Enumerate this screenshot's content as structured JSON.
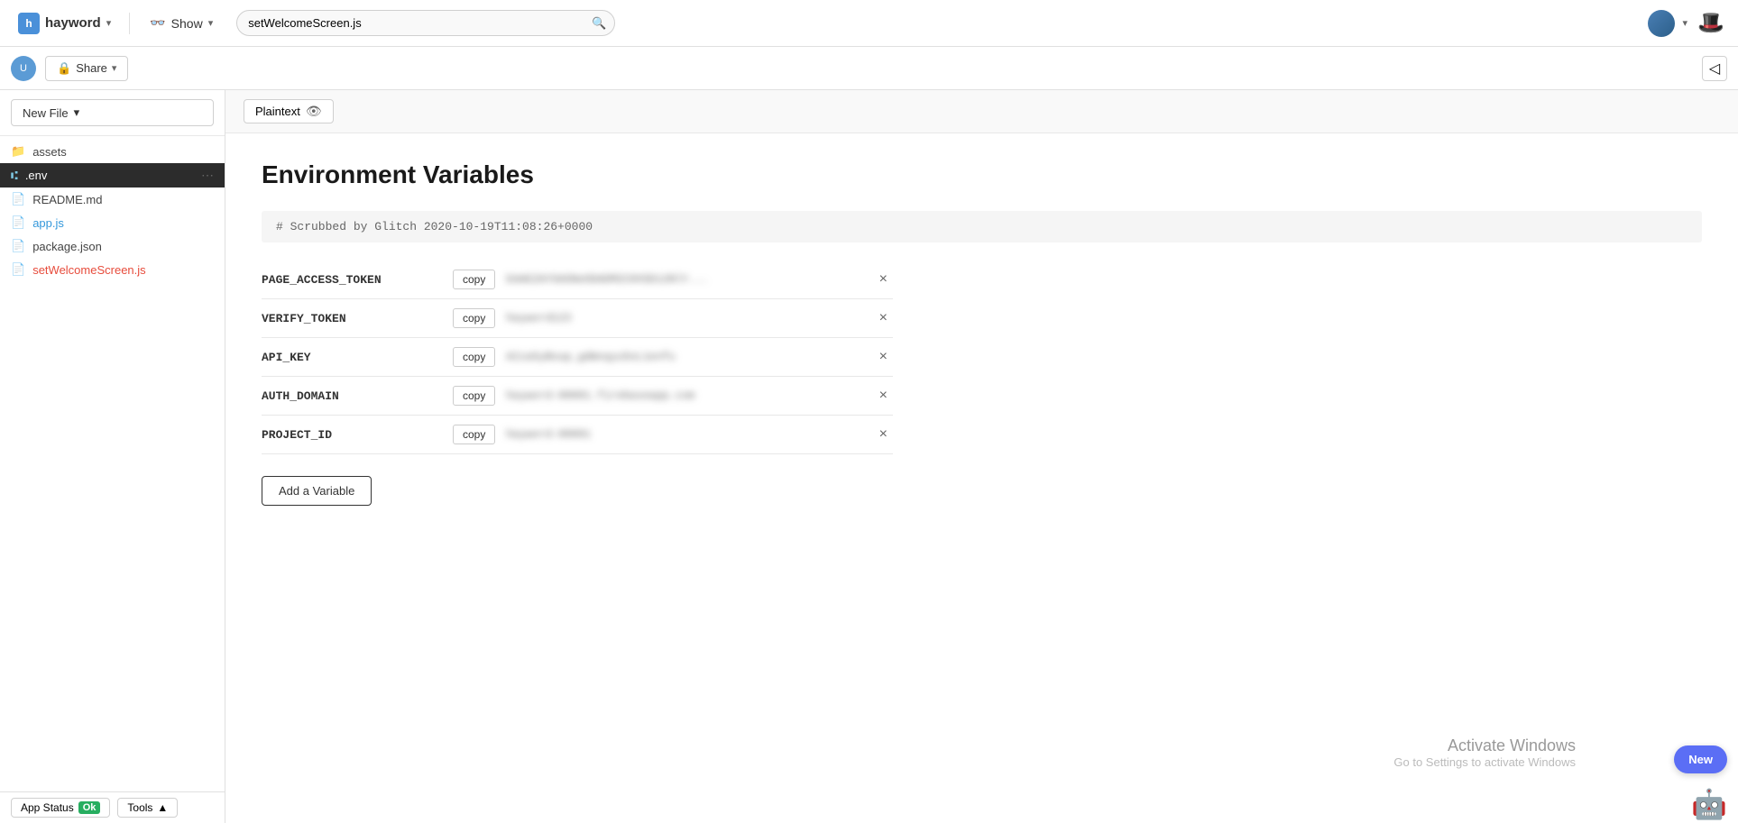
{
  "topNav": {
    "brand": "hayword",
    "showLabel": "Show",
    "searchPlaceholder": "setWelcomeScreen.js",
    "searchValue": "setWelcomeScreen.js"
  },
  "secondNav": {
    "shareLabel": "Share",
    "collapseTitle": "Collapse sidebar"
  },
  "sidebar": {
    "newFileLabel": "New File",
    "files": [
      {
        "name": "assets",
        "type": "folder",
        "icon": "📁"
      },
      {
        "name": ".env",
        "type": "file",
        "icon": "git",
        "active": true
      },
      {
        "name": "README.md",
        "type": "file",
        "icon": "doc"
      },
      {
        "name": "app.js",
        "type": "file",
        "icon": "js",
        "colored": "blue"
      },
      {
        "name": "package.json",
        "type": "file",
        "icon": "json"
      },
      {
        "name": "setWelcomeScreen.js",
        "type": "file",
        "icon": "js",
        "colored": "red"
      }
    ]
  },
  "statusBar": {
    "appStatusLabel": "App Status",
    "okLabel": "Ok",
    "toolsLabel": "Tools"
  },
  "content": {
    "plaintextLabel": "Plaintext",
    "pageTitle": "Environment Variables",
    "commentLine": "# Scrubbed by Glitch 2020-10-19T11:08:26+0000",
    "variables": [
      {
        "name": "PAGE_ACCESS_TOKEN",
        "copyLabel": "copy",
        "value": "EAAEZAYSASNeODADM2C0XSD12NlY...",
        "deleteLabel": "×"
      },
      {
        "name": "VERIFY_TOKEN",
        "copyLabel": "copy",
        "value": "hayword123",
        "deleteLabel": "×"
      },
      {
        "name": "API_KEY",
        "copyLabel": "copy",
        "value": "AIzaSyBoup_gdWvqyu5oL1enf",
        "deleteLabel": "×"
      },
      {
        "name": "AUTH_DOMAIN",
        "copyLabel": "copy",
        "value": "hayword-00001.firebaseapp.com",
        "deleteLabel": "×"
      },
      {
        "name": "PROJECT_ID",
        "copyLabel": "copy",
        "value": "hayword-00001",
        "deleteLabel": "×"
      }
    ],
    "addVariableLabel": "Add a Variable"
  },
  "windowsActivation": {
    "title": "Activate Windows",
    "subtitle": "Go to Settings to activate Windows"
  },
  "newButton": {
    "label": "New"
  }
}
